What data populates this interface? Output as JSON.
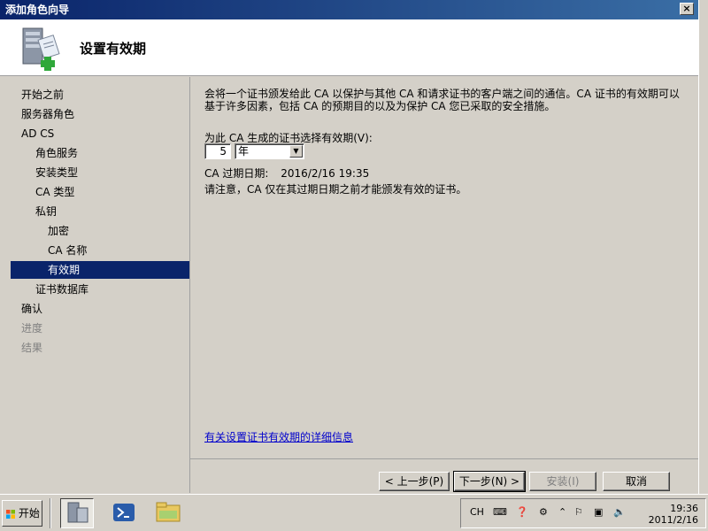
{
  "window": {
    "title": "添加角色向导",
    "close_label": "×",
    "header_title": "设置有效期"
  },
  "nav": {
    "items": [
      {
        "label": "开始之前",
        "state": "normal"
      },
      {
        "label": "服务器角色",
        "state": "normal"
      },
      {
        "label": "AD CS",
        "state": "normal"
      },
      {
        "label": "角色服务",
        "state": "normal"
      },
      {
        "label": "安装类型",
        "state": "normal"
      },
      {
        "label": "CA 类型",
        "state": "normal"
      },
      {
        "label": "私钥",
        "state": "normal"
      },
      {
        "label": "加密",
        "state": "normal"
      },
      {
        "label": "CA 名称",
        "state": "normal"
      },
      {
        "label": "有效期",
        "state": "selected"
      },
      {
        "label": "证书数据库",
        "state": "normal"
      },
      {
        "label": "确认",
        "state": "normal"
      },
      {
        "label": "进度",
        "state": "disabled"
      },
      {
        "label": "结果",
        "state": "disabled"
      }
    ]
  },
  "content": {
    "description": "会将一个证书颁发给此 CA 以保护与其他 CA 和请求证书的客户端之间的通信。CA 证书的有效期可以基于许多因素，包括 CA 的预期目的以及为保护 CA 您已采取的安全措施。",
    "validity_label": "为此 CA 生成的证书选择有效期(V):",
    "validity_value": "5",
    "validity_unit": "年",
    "expiry_label": "CA 过期日期:",
    "expiry_value": "2016/2/16 19:35",
    "notice": "请注意，CA 仅在其过期日期之前才能颁发有效的证书。",
    "help_link": "有关设置证书有效期的详细信息"
  },
  "buttons": {
    "back": "< 上一步(P)",
    "next": "下一步(N) >",
    "install": "安装(I)",
    "cancel": "取消"
  },
  "taskbar": {
    "start_label": "开始",
    "tray_lang": "CH",
    "clock_time": "19:36",
    "clock_date": "2011/2/16"
  },
  "colors": {
    "titlebar": "#0a246a",
    "selection": "#0a246a",
    "link": "#0000cc"
  }
}
